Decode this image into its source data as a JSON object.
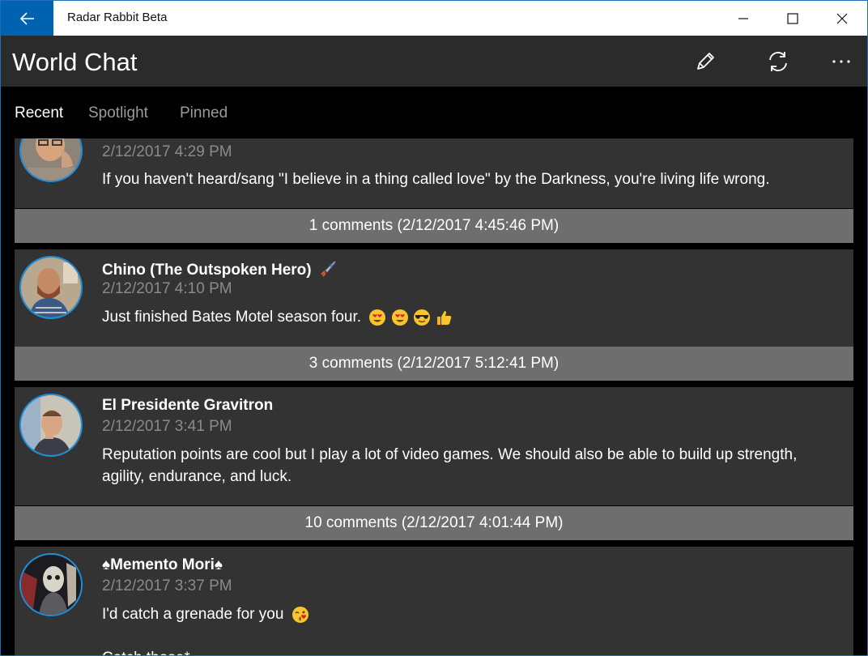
{
  "window": {
    "app_title": "Radar Rabbit Beta"
  },
  "header": {
    "title": "World Chat"
  },
  "tabs": [
    {
      "label": "Recent",
      "active": true
    },
    {
      "label": "Spotlight",
      "active": false
    },
    {
      "label": "Pinned",
      "active": false
    }
  ],
  "posts": [
    {
      "author": "",
      "time": "2/12/2017 4:29 PM",
      "message": "If you haven't heard/sang \"I believe in a  thing called love\" by the Darkness, you're living life wrong.",
      "comments": "1 comments (2/12/2017 4:45:46 PM)"
    },
    {
      "author": "Chino (The Outspoken Hero)",
      "time": "2/12/2017 4:10 PM",
      "message": "Just finished Bates Motel season four.",
      "emojis": [
        "heart-eyes-emoji",
        "heart-eyes-emoji",
        "sunglasses-emoji",
        "thumbs-up-emoji"
      ],
      "comments": "3 comments (2/12/2017 5:12:41 PM)"
    },
    {
      "author": "El Presidente Gravitron",
      "time": "2/12/2017 3:41 PM",
      "message": "Reputation points are cool but I play a lot of video games. We should also be able to build up strength, agility, endurance, and luck.",
      "comments": "10 comments (2/12/2017 4:01:44 PM)"
    },
    {
      "author": "♠Memento Mori♠",
      "time": "2/12/2017 3:37 PM",
      "message": "I'd catch a grenade for you",
      "emojis": [
        "kiss-wink-emoji"
      ],
      "message_2": "Catch those*"
    }
  ],
  "colors": {
    "accent": "#0063b1",
    "card_bg": "#333333",
    "comments_bg": "#6e6e6e",
    "avatar_ring": "#1b8fe0"
  }
}
